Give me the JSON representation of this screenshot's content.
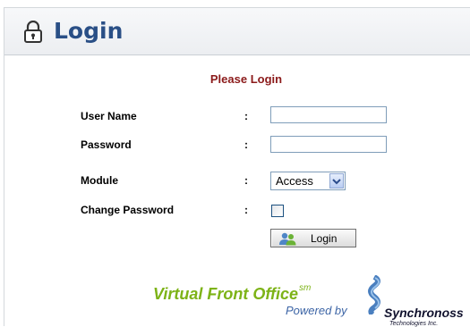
{
  "header": {
    "title": "Login",
    "icon": "lock-icon"
  },
  "form": {
    "heading": "Please Login",
    "username": {
      "label": "User Name",
      "colon": ":",
      "value": ""
    },
    "password": {
      "label": "Password",
      "colon": ":",
      "value": ""
    },
    "module": {
      "label": "Module",
      "colon": ":",
      "selected": "Access"
    },
    "change_password": {
      "label": "Change Password",
      "colon": ":",
      "checked": false
    },
    "login_button": {
      "label": "Login",
      "icon": "users-icon"
    }
  },
  "footer": {
    "product": "Virtual Front Office",
    "product_mark": "sm",
    "powered_by": "Powered by",
    "company": "Synchronoss",
    "company_sub": "Technologies Inc."
  },
  "colors": {
    "title": "#2a4f86",
    "heading": "#8b1a1a",
    "product": "#7db317",
    "powered_by": "#3d65a6"
  }
}
